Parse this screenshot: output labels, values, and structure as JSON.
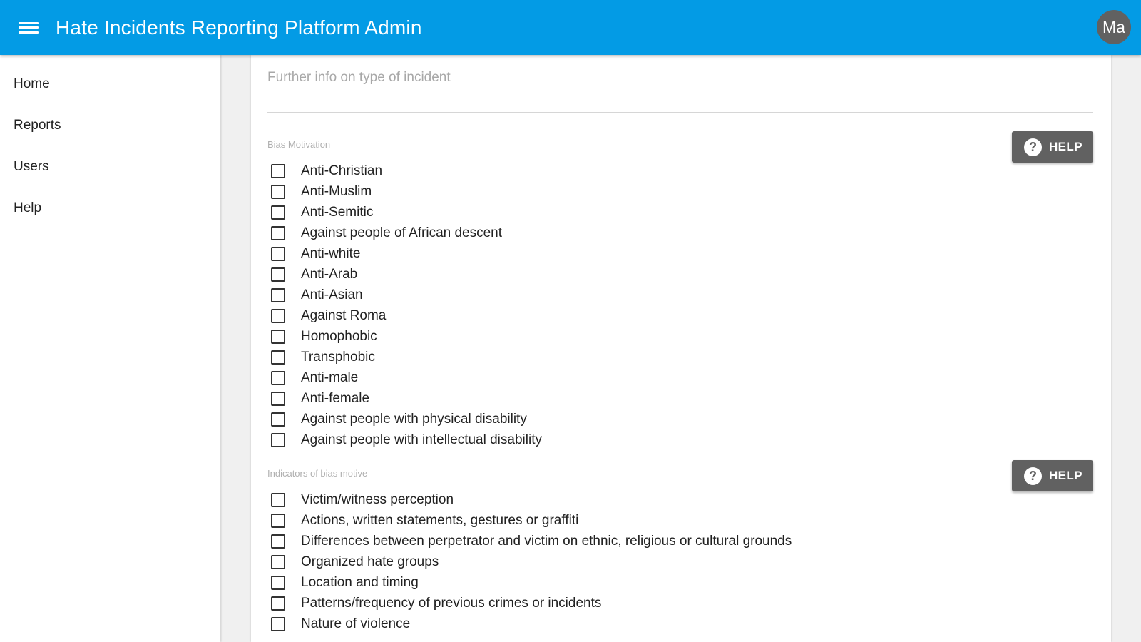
{
  "header": {
    "title": "Hate Incidents Reporting Platform Admin",
    "avatar_initials": "Ma"
  },
  "sidebar": {
    "items": [
      {
        "label": "Home"
      },
      {
        "label": "Reports"
      },
      {
        "label": "Users"
      },
      {
        "label": "Help"
      }
    ]
  },
  "form": {
    "further_info": {
      "placeholder": "Further info on type of incident",
      "value": ""
    },
    "bias_motivation": {
      "label": "Bias Motivation",
      "help_label": "HELP",
      "options": [
        {
          "label": "Anti-Christian",
          "checked": false
        },
        {
          "label": "Anti-Muslim",
          "checked": false
        },
        {
          "label": "Anti-Semitic",
          "checked": false
        },
        {
          "label": "Against people of African descent",
          "checked": false
        },
        {
          "label": "Anti-white",
          "checked": false
        },
        {
          "label": "Anti-Arab",
          "checked": false
        },
        {
          "label": "Anti-Asian",
          "checked": false
        },
        {
          "label": "Against Roma",
          "checked": false
        },
        {
          "label": "Homophobic",
          "checked": false
        },
        {
          "label": "Transphobic",
          "checked": false
        },
        {
          "label": "Anti-male",
          "checked": false
        },
        {
          "label": "Anti-female",
          "checked": false
        },
        {
          "label": "Against people with physical disability",
          "checked": false
        },
        {
          "label": "Against people with intellectual disability",
          "checked": false
        }
      ]
    },
    "indicators": {
      "label": "Indicators of bias motive",
      "help_label": "HELP",
      "options": [
        {
          "label": "Victim/witness perception",
          "checked": false
        },
        {
          "label": "Actions, written statements, gestures or graffiti",
          "checked": false
        },
        {
          "label": "Differences between perpetrator and victim on ethnic, religious or cultural grounds",
          "checked": false
        },
        {
          "label": "Organized hate groups",
          "checked": false
        },
        {
          "label": "Location and timing",
          "checked": false
        },
        {
          "label": "Patterns/frequency of previous crimes or incidents",
          "checked": false
        },
        {
          "label": "Nature of violence",
          "checked": false
        }
      ]
    }
  },
  "colors": {
    "app_bar": "#039be5",
    "help_button": "#616161",
    "avatar": "#616161"
  },
  "icons": {
    "menu": "menu-icon",
    "help": "help-circle-icon",
    "checkbox": "checkbox-unchecked-icon"
  }
}
